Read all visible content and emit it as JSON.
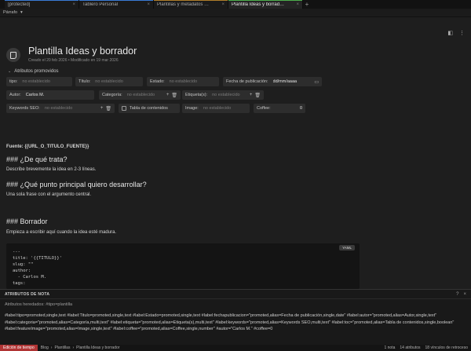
{
  "tabs": [
    {
      "label": "[protected]",
      "color": "#3a7bd5",
      "active": false
    },
    {
      "label": "Tablero Personal",
      "color": "#3a7bd5",
      "active": false
    },
    {
      "label": "Plantillas y metadatos …",
      "color": "#b07d2a",
      "active": false
    },
    {
      "label": "Plantilla Ideas y borrad…",
      "color": "#4cae4c",
      "active": true
    }
  ],
  "toolbar": {
    "paragraph_label": "Párrafo"
  },
  "note": {
    "title": "Plantilla Ideas y borrador",
    "meta": "Creado el 20 feb 2026 • Modificado en 19 mar 2026"
  },
  "promoted": {
    "toggle_label": "Atributos promovidos",
    "tipo": {
      "label": "tipo:",
      "placeholder": "no establecido"
    },
    "titulo": {
      "label": "Título:",
      "placeholder": "no establecido"
    },
    "estado": {
      "label": "Estado:",
      "placeholder": "no establecido"
    },
    "fecha": {
      "label": "Fecha de publicación:",
      "value": "dd/mm/aaaa"
    },
    "autor": {
      "label": "Autor:",
      "value": "Carlos M."
    },
    "categoria": {
      "label": "Categoría:",
      "placeholder": "no establecido"
    },
    "etiquetas": {
      "label": "Etiqueta(s):",
      "placeholder": "no establecido"
    },
    "keywords": {
      "label": "Keywords SEO:",
      "placeholder": "no establecido"
    },
    "toc": {
      "label": "Tabla de contenidos"
    },
    "image": {
      "label": "Image:",
      "placeholder": "no establecido"
    },
    "coffee": {
      "label": "Coffee:",
      "value": "0"
    }
  },
  "body": {
    "fuente": "Fuente: {{URL_O_TITULO_FUENTE}}",
    "h1": "### ¿De qué trata?",
    "p1": "Describe brevemente la idea en 2-3 líneas.",
    "h2": "### ¿Qué punto principal quiero desarrollar?",
    "p2": "Una sola frase con el argumento central.",
    "h3": "### Borrador",
    "p3": "Empieza a escribir aquí cuando la idea esté madura.",
    "code_lang": "YAML",
    "code_lines": [
      "---",
      "title: '{{TITULO}}'",
      "slug: \"\"",
      "author:",
      "  - Carlos M.",
      "tags:"
    ]
  },
  "attr_panel": {
    "title": "ATRIBUTOS DE NOTA",
    "inherited": "Atributos heredados: #tipo=plantilla",
    "attrs": "#label:tipo=promoted,single,text #label:Titulo=promoted,single,text #label:Estado=promoted,single,text #label:fechapublicacion=\"promoted,alias=Fecha de publicación,single,date\" #label:autor=\"promoted,alias=Autor,single,text\" #label:categoria=\"promoted,alias=Categoría,multi,text\" #label:etiqueta=\"promoted,alias=Etiqueta(s),multi,text\" #label:keywords=\"promoted,alias=Keywords SEO,multi,text\" #label:toc=\"promoted,alias=Tabla de contenidos,single,boolean\" #label:featureImage=\"promoted,alias=Image,single,text\" #label:coffee=\"promoted,alias=Coffee,single,number\" #autor=\"Carlos M.\" #coffee=0"
  },
  "status": {
    "mode": "Edición de tiempo",
    "crumbs": [
      "Blog",
      "Plantillas",
      "Plantilla Ideas y borrador"
    ],
    "right": [
      "1 nota",
      "14 atributos",
      "18 vínculos de retroceso"
    ]
  }
}
